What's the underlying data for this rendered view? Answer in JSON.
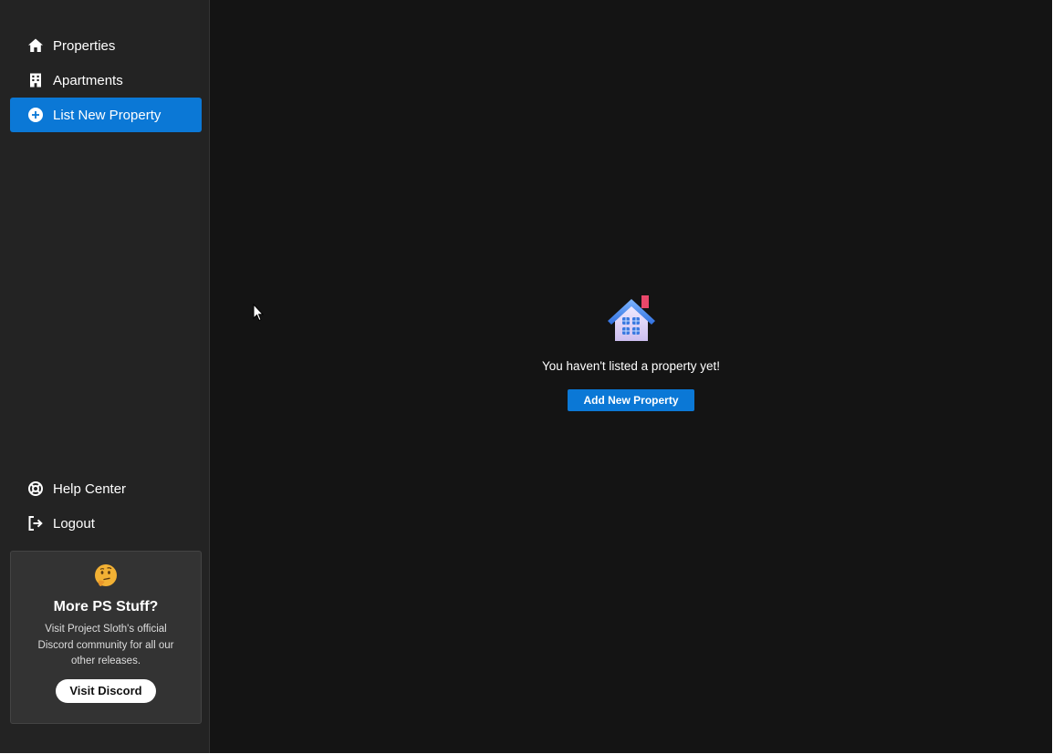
{
  "sidebar": {
    "nav_top": [
      {
        "label": "Properties",
        "icon": "home-icon",
        "active": false
      },
      {
        "label": "Apartments",
        "icon": "building-icon",
        "active": false
      },
      {
        "label": "List New Property",
        "icon": "plus-circle-icon",
        "active": true
      }
    ],
    "nav_bottom": [
      {
        "label": "Help Center",
        "icon": "lifebuoy-icon"
      },
      {
        "label": "Logout",
        "icon": "logout-icon"
      }
    ],
    "promo": {
      "emoji": "thinking-face-icon",
      "title": "More PS Stuff?",
      "text": "Visit Project Sloth's official Discord community for all our other releases.",
      "button_label": "Visit Discord"
    }
  },
  "main": {
    "empty_state": {
      "icon": "house-icon",
      "message": "You haven't listed a property yet!",
      "button_label": "Add New Property"
    }
  },
  "colors": {
    "sidebar_bg": "#232323",
    "main_bg": "#141414",
    "accent": "#0b78d6",
    "promo_bg": "#333333"
  }
}
